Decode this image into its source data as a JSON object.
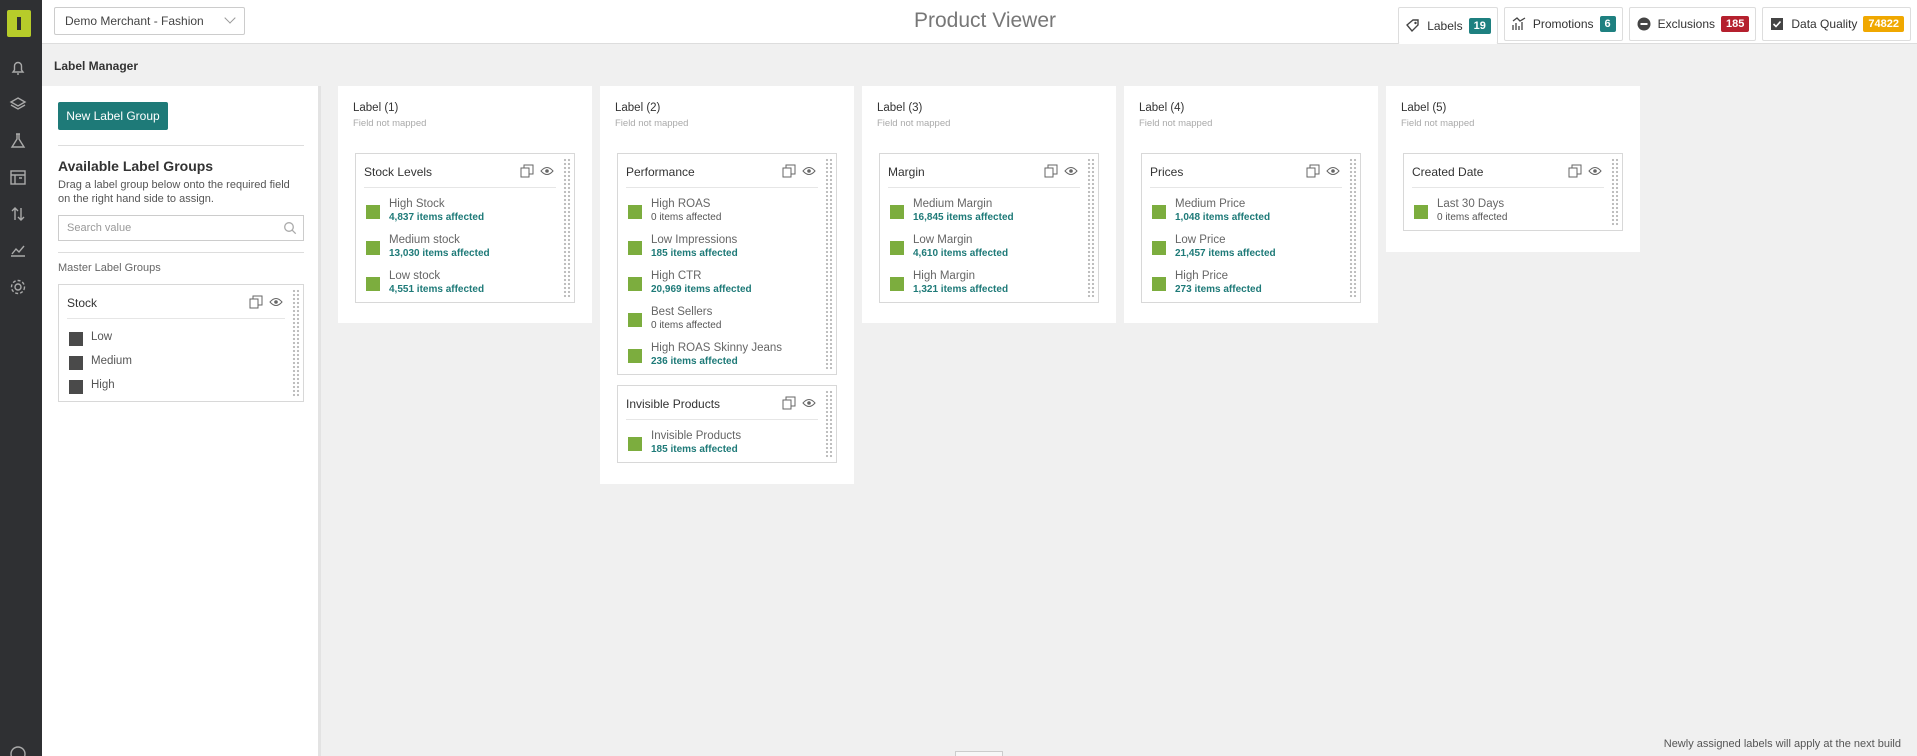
{
  "topbar": {
    "merchant": "Demo Merchant - Fashion",
    "title": "Product Viewer",
    "tabs": [
      {
        "label": "Labels",
        "count": "19",
        "color": "#1e8080"
      },
      {
        "label": "Promotions",
        "count": "6",
        "color": "#1e8080"
      },
      {
        "label": "Exclusions",
        "count": "185",
        "color": "#b5202e"
      },
      {
        "label": "Data Quality",
        "count": "74822",
        "color": "#f0a800"
      }
    ]
  },
  "page": {
    "section_title": "Label Manager",
    "footer_note": "Newly assigned labels will apply at the next build"
  },
  "left": {
    "new_group_button": "New Label Group",
    "available_title": "Available Label Groups",
    "available_desc": "Drag a label group below onto the required field on the right hand side to assign.",
    "search_placeholder": "Search value",
    "master_title": "Master Label Groups",
    "master_group": {
      "name": "Stock",
      "items": [
        "Low",
        "Medium",
        "High"
      ]
    }
  },
  "labels": [
    {
      "title": "Label (1)",
      "subtitle": "Field not mapped",
      "groups": [
        {
          "name": "Stock Levels",
          "items": [
            {
              "name": "High Stock",
              "count": "4,837 items affected"
            },
            {
              "name": "Medium stock",
              "count": "13,030 items affected"
            },
            {
              "name": "Low stock",
              "count": "4,551 items affected"
            }
          ]
        }
      ]
    },
    {
      "title": "Label (2)",
      "subtitle": "Field not mapped",
      "groups": [
        {
          "name": "Performance",
          "items": [
            {
              "name": "High ROAS",
              "count": "0 items affected"
            },
            {
              "name": "Low Impressions",
              "count": "185 items affected"
            },
            {
              "name": "High CTR",
              "count": "20,969 items affected"
            },
            {
              "name": "Best Sellers",
              "count": "0 items affected"
            },
            {
              "name": "High ROAS Skinny Jeans",
              "count": "236 items affected"
            }
          ]
        },
        {
          "name": "Invisible Products",
          "items": [
            {
              "name": "Invisible Products",
              "count": "185 items affected"
            }
          ]
        }
      ]
    },
    {
      "title": "Label (3)",
      "subtitle": "Field not mapped",
      "groups": [
        {
          "name": "Margin",
          "items": [
            {
              "name": "Medium Margin",
              "count": "16,845 items affected"
            },
            {
              "name": "Low Margin",
              "count": "4,610 items affected"
            },
            {
              "name": "High Margin",
              "count": "1,321 items affected"
            }
          ]
        }
      ]
    },
    {
      "title": "Label (4)",
      "subtitle": "Field not mapped",
      "groups": [
        {
          "name": "Prices",
          "items": [
            {
              "name": "Medium Price",
              "count": "1,048 items affected"
            },
            {
              "name": "Low Price",
              "count": "21,457 items affected"
            },
            {
              "name": "High Price",
              "count": "273 items affected"
            }
          ]
        }
      ]
    },
    {
      "title": "Label (5)",
      "subtitle": "Field not mapped",
      "groups": [
        {
          "name": "Created Date",
          "items": [
            {
              "name": "Last 30 Days",
              "count": "0 items affected"
            }
          ]
        }
      ]
    }
  ]
}
